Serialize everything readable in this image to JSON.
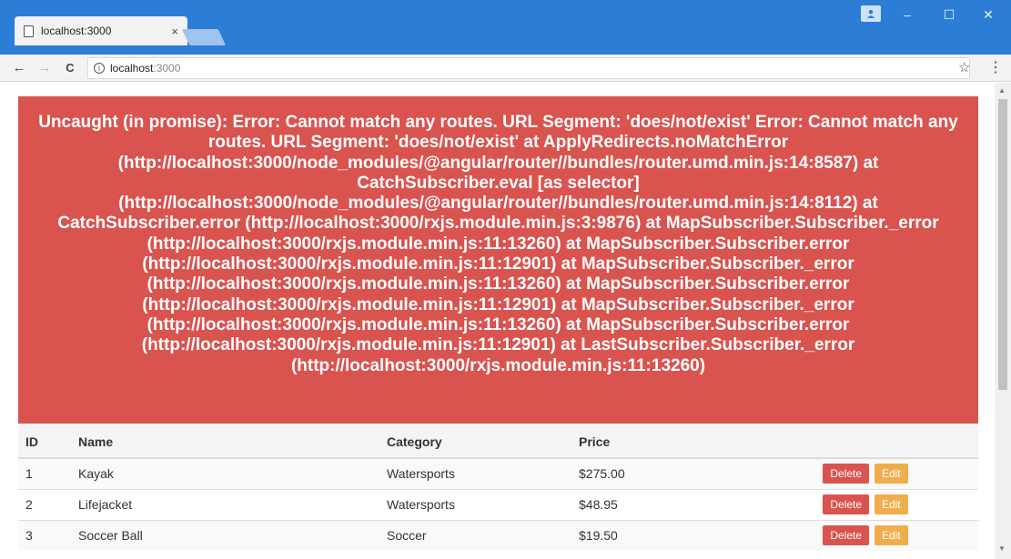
{
  "browser": {
    "tab_title": "localhost:3000",
    "tab_close": "×",
    "address": "localhost:3000",
    "url_host": "localhost",
    "url_port": ":3000",
    "window_buttons": [
      "–",
      "☐",
      "✕"
    ]
  },
  "error": {
    "message": "Uncaught (in promise): Error: Cannot match any routes. URL Segment: 'does/not/exist' Error: Cannot match any routes. URL Segment: 'does/not/exist' at ApplyRedirects.noMatchError (http://localhost:3000/node_modules/@angular/router//bundles/router.umd.min.js:14:8587) at CatchSubscriber.eval [as selector] (http://localhost:3000/node_modules/@angular/router//bundles/router.umd.min.js:14:8112) at CatchSubscriber.error (http://localhost:3000/rxjs.module.min.js:3:9876) at MapSubscriber.Subscriber._error (http://localhost:3000/rxjs.module.min.js:11:13260) at MapSubscriber.Subscriber.error (http://localhost:3000/rxjs.module.min.js:11:12901) at MapSubscriber.Subscriber._error (http://localhost:3000/rxjs.module.min.js:11:13260) at MapSubscriber.Subscriber.error (http://localhost:3000/rxjs.module.min.js:11:12901) at MapSubscriber.Subscriber._error (http://localhost:3000/rxjs.module.min.js:11:13260) at MapSubscriber.Subscriber.error (http://localhost:3000/rxjs.module.min.js:11:12901) at LastSubscriber.Subscriber._error (http://localhost:3000/rxjs.module.min.js:11:13260)"
  },
  "table": {
    "headers": {
      "id": "ID",
      "name": "Name",
      "category": "Category",
      "price": "Price"
    },
    "rows": [
      {
        "id": "1",
        "name": "Kayak",
        "category": "Watersports",
        "price": "$275.00"
      },
      {
        "id": "2",
        "name": "Lifejacket",
        "category": "Watersports",
        "price": "$48.95"
      },
      {
        "id": "3",
        "name": "Soccer Ball",
        "category": "Soccer",
        "price": "$19.50"
      }
    ],
    "delete_label": "Delete",
    "edit_label": "Edit"
  },
  "colors": {
    "titlebar": "#2b7dd6",
    "error_bg": "#d9534f",
    "delete_btn": "#d9534f",
    "edit_btn": "#f0ad4e"
  }
}
